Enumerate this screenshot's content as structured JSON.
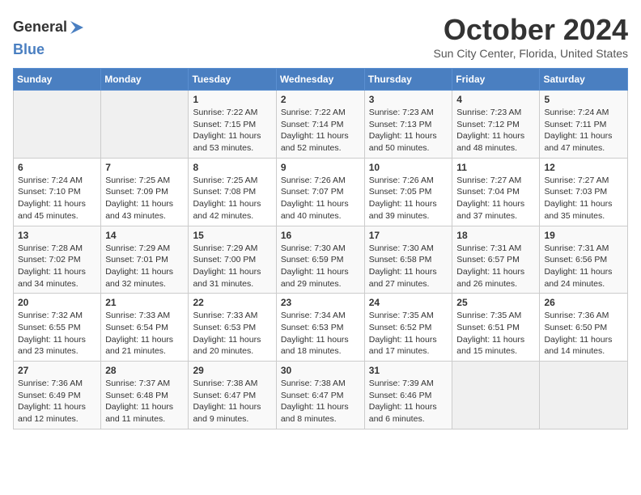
{
  "header": {
    "logo_general": "General",
    "logo_blue": "Blue",
    "month": "October 2024",
    "location": "Sun City Center, Florida, United States"
  },
  "weekdays": [
    "Sunday",
    "Monday",
    "Tuesday",
    "Wednesday",
    "Thursday",
    "Friday",
    "Saturday"
  ],
  "weeks": [
    [
      {
        "day": "",
        "info": ""
      },
      {
        "day": "",
        "info": ""
      },
      {
        "day": "1",
        "info": "Sunrise: 7:22 AM\nSunset: 7:15 PM\nDaylight: 11 hours and 53 minutes."
      },
      {
        "day": "2",
        "info": "Sunrise: 7:22 AM\nSunset: 7:14 PM\nDaylight: 11 hours and 52 minutes."
      },
      {
        "day": "3",
        "info": "Sunrise: 7:23 AM\nSunset: 7:13 PM\nDaylight: 11 hours and 50 minutes."
      },
      {
        "day": "4",
        "info": "Sunrise: 7:23 AM\nSunset: 7:12 PM\nDaylight: 11 hours and 48 minutes."
      },
      {
        "day": "5",
        "info": "Sunrise: 7:24 AM\nSunset: 7:11 PM\nDaylight: 11 hours and 47 minutes."
      }
    ],
    [
      {
        "day": "6",
        "info": "Sunrise: 7:24 AM\nSunset: 7:10 PM\nDaylight: 11 hours and 45 minutes."
      },
      {
        "day": "7",
        "info": "Sunrise: 7:25 AM\nSunset: 7:09 PM\nDaylight: 11 hours and 43 minutes."
      },
      {
        "day": "8",
        "info": "Sunrise: 7:25 AM\nSunset: 7:08 PM\nDaylight: 11 hours and 42 minutes."
      },
      {
        "day": "9",
        "info": "Sunrise: 7:26 AM\nSunset: 7:07 PM\nDaylight: 11 hours and 40 minutes."
      },
      {
        "day": "10",
        "info": "Sunrise: 7:26 AM\nSunset: 7:05 PM\nDaylight: 11 hours and 39 minutes."
      },
      {
        "day": "11",
        "info": "Sunrise: 7:27 AM\nSunset: 7:04 PM\nDaylight: 11 hours and 37 minutes."
      },
      {
        "day": "12",
        "info": "Sunrise: 7:27 AM\nSunset: 7:03 PM\nDaylight: 11 hours and 35 minutes."
      }
    ],
    [
      {
        "day": "13",
        "info": "Sunrise: 7:28 AM\nSunset: 7:02 PM\nDaylight: 11 hours and 34 minutes."
      },
      {
        "day": "14",
        "info": "Sunrise: 7:29 AM\nSunset: 7:01 PM\nDaylight: 11 hours and 32 minutes."
      },
      {
        "day": "15",
        "info": "Sunrise: 7:29 AM\nSunset: 7:00 PM\nDaylight: 11 hours and 31 minutes."
      },
      {
        "day": "16",
        "info": "Sunrise: 7:30 AM\nSunset: 6:59 PM\nDaylight: 11 hours and 29 minutes."
      },
      {
        "day": "17",
        "info": "Sunrise: 7:30 AM\nSunset: 6:58 PM\nDaylight: 11 hours and 27 minutes."
      },
      {
        "day": "18",
        "info": "Sunrise: 7:31 AM\nSunset: 6:57 PM\nDaylight: 11 hours and 26 minutes."
      },
      {
        "day": "19",
        "info": "Sunrise: 7:31 AM\nSunset: 6:56 PM\nDaylight: 11 hours and 24 minutes."
      }
    ],
    [
      {
        "day": "20",
        "info": "Sunrise: 7:32 AM\nSunset: 6:55 PM\nDaylight: 11 hours and 23 minutes."
      },
      {
        "day": "21",
        "info": "Sunrise: 7:33 AM\nSunset: 6:54 PM\nDaylight: 11 hours and 21 minutes."
      },
      {
        "day": "22",
        "info": "Sunrise: 7:33 AM\nSunset: 6:53 PM\nDaylight: 11 hours and 20 minutes."
      },
      {
        "day": "23",
        "info": "Sunrise: 7:34 AM\nSunset: 6:53 PM\nDaylight: 11 hours and 18 minutes."
      },
      {
        "day": "24",
        "info": "Sunrise: 7:35 AM\nSunset: 6:52 PM\nDaylight: 11 hours and 17 minutes."
      },
      {
        "day": "25",
        "info": "Sunrise: 7:35 AM\nSunset: 6:51 PM\nDaylight: 11 hours and 15 minutes."
      },
      {
        "day": "26",
        "info": "Sunrise: 7:36 AM\nSunset: 6:50 PM\nDaylight: 11 hours and 14 minutes."
      }
    ],
    [
      {
        "day": "27",
        "info": "Sunrise: 7:36 AM\nSunset: 6:49 PM\nDaylight: 11 hours and 12 minutes."
      },
      {
        "day": "28",
        "info": "Sunrise: 7:37 AM\nSunset: 6:48 PM\nDaylight: 11 hours and 11 minutes."
      },
      {
        "day": "29",
        "info": "Sunrise: 7:38 AM\nSunset: 6:47 PM\nDaylight: 11 hours and 9 minutes."
      },
      {
        "day": "30",
        "info": "Sunrise: 7:38 AM\nSunset: 6:47 PM\nDaylight: 11 hours and 8 minutes."
      },
      {
        "day": "31",
        "info": "Sunrise: 7:39 AM\nSunset: 6:46 PM\nDaylight: 11 hours and 6 minutes."
      },
      {
        "day": "",
        "info": ""
      },
      {
        "day": "",
        "info": ""
      }
    ]
  ]
}
